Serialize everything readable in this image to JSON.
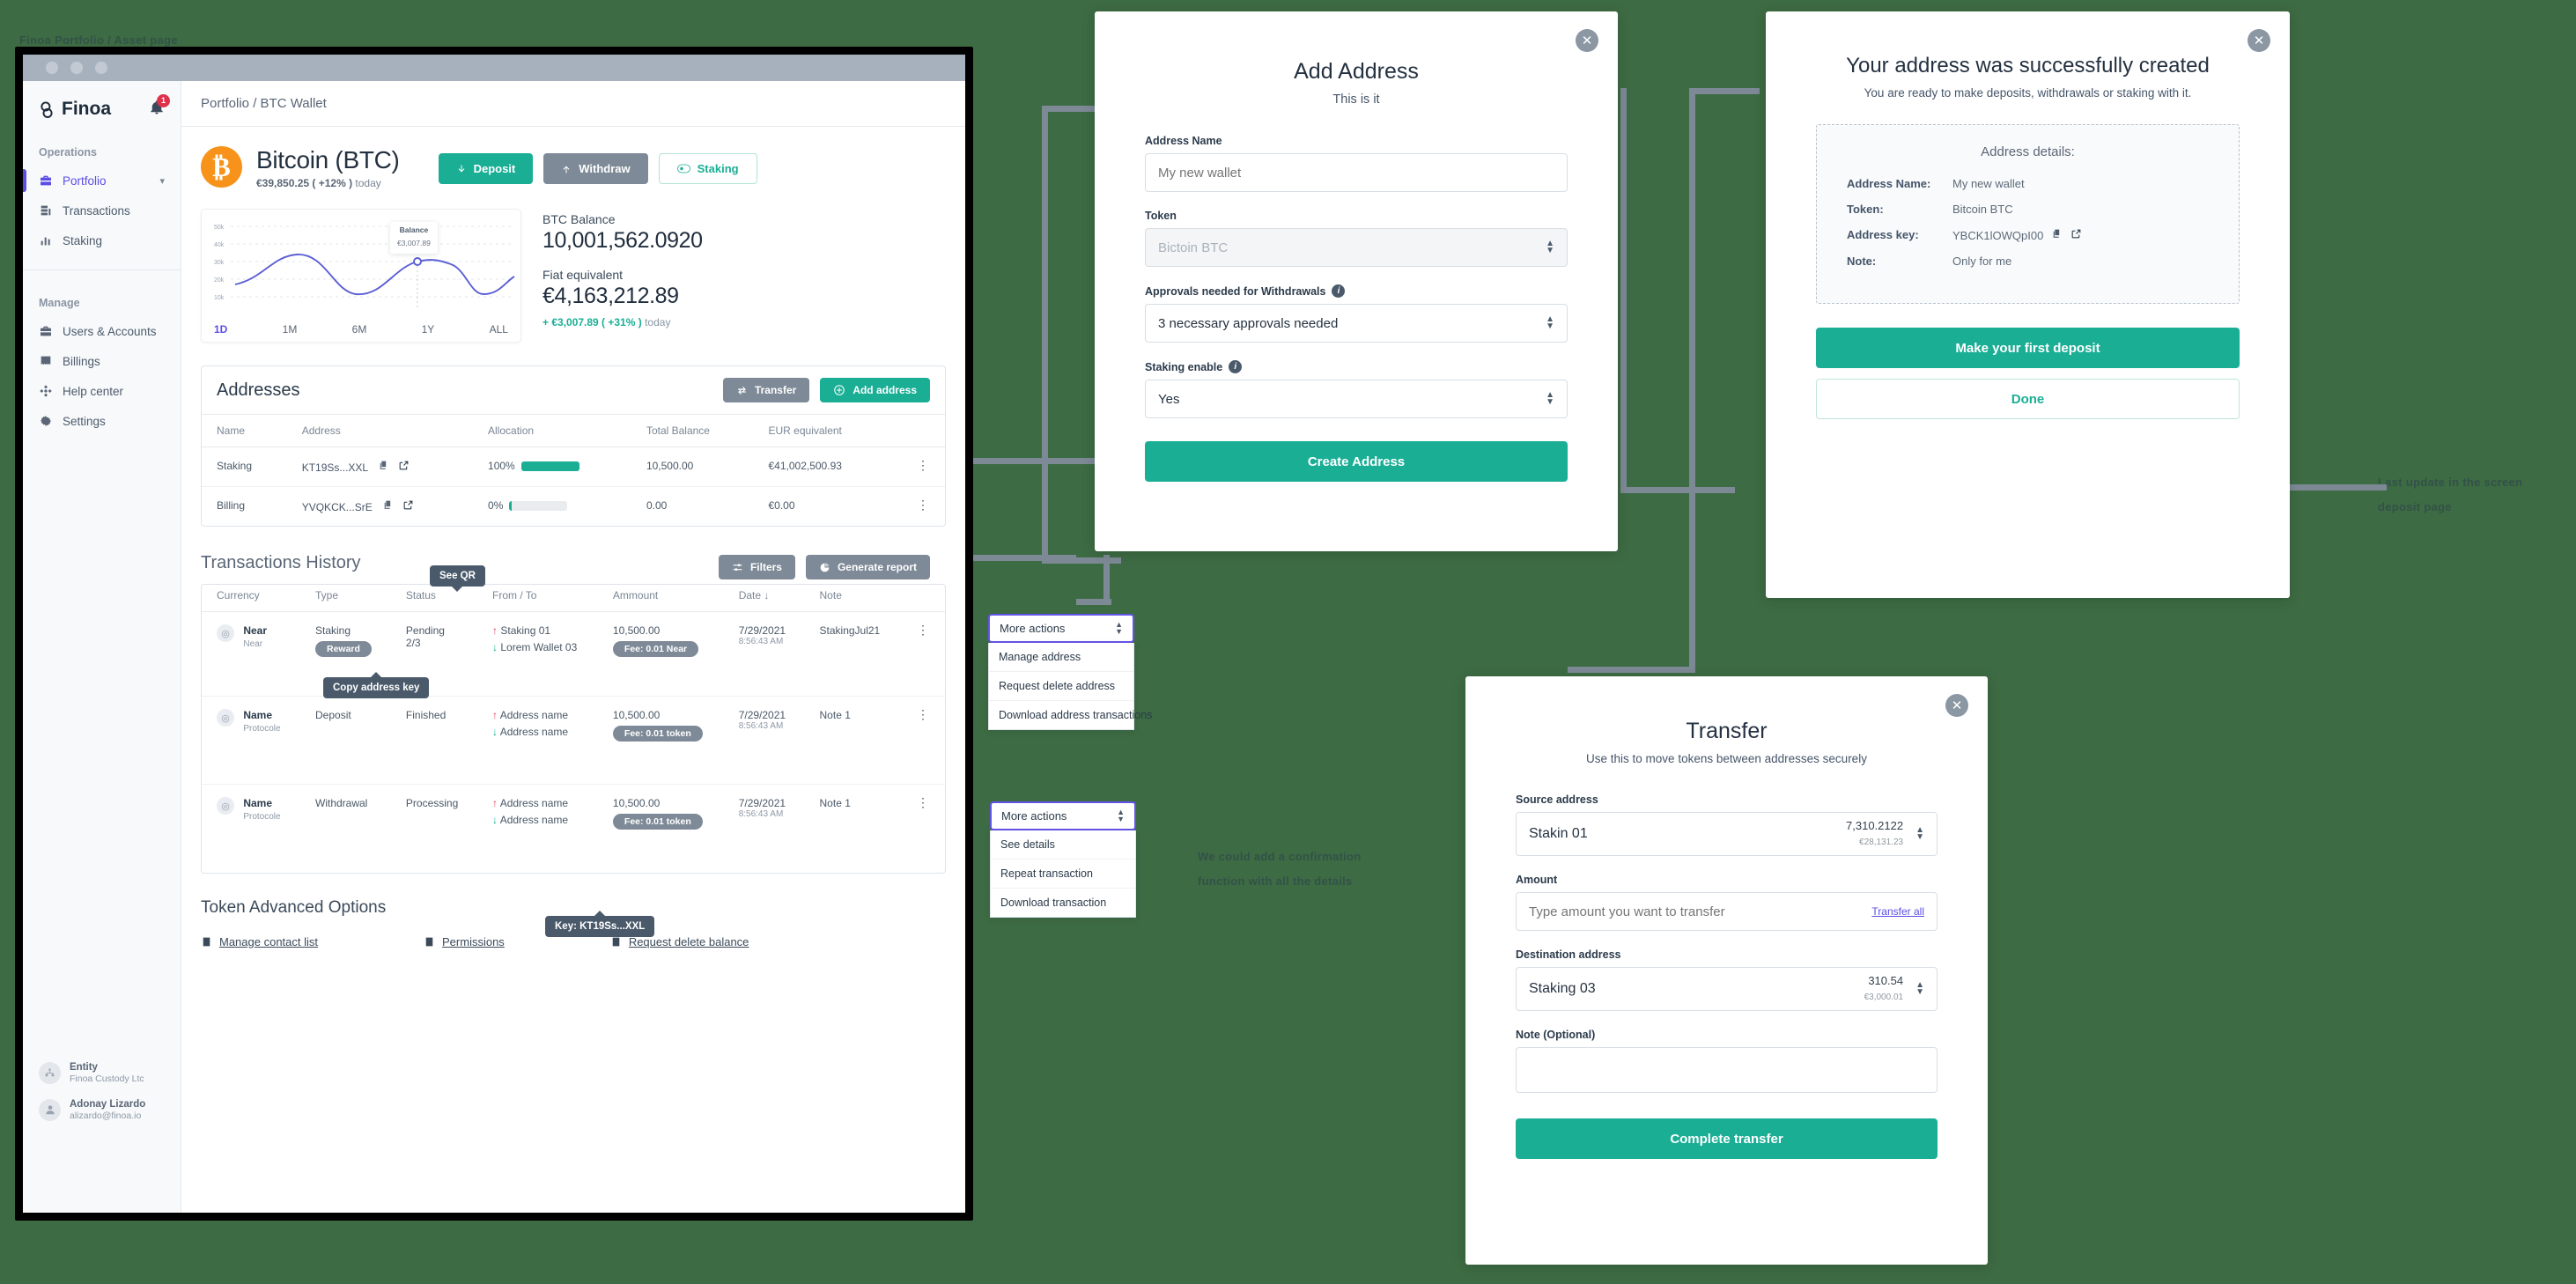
{
  "sketch": {
    "top_label": "Finoa Portfolio / Asset page",
    "right_note_line1": "Last update in the screen",
    "right_note_line2": "deposit page",
    "mid_note_line1": "We could add a confirmation",
    "mid_note_line2": "function with all the details"
  },
  "app": {
    "breadcrumb": "Portfolio / BTC Wallet",
    "brand": "Finoa",
    "notification_count": "1",
    "sidebar": {
      "group_operations": "Operations",
      "group_manage": "Manage",
      "items_operations": [
        {
          "label": "Portfolio",
          "icon": "briefcase-icon",
          "active": true
        },
        {
          "label": "Transactions",
          "icon": "list-icon",
          "active": false
        },
        {
          "label": "Staking",
          "icon": "bars-icon",
          "active": false
        }
      ],
      "items_manage": [
        {
          "label": "Users & Accounts",
          "icon": "briefcase-icon"
        },
        {
          "label": "Billings",
          "icon": "receipt-icon"
        },
        {
          "label": "Help center",
          "icon": "help-icon"
        },
        {
          "label": "Settings",
          "icon": "gear-icon"
        }
      ],
      "entity_label": "Entity",
      "entity_value": "Finoa Custody Ltc",
      "user_name": "Adonay Lizardo",
      "user_email": "alizardo@finoa.io"
    },
    "asset": {
      "name": "Bitcoin (BTC)",
      "price": "€39,850.25 ( +12% )",
      "price_period": "today",
      "symbol": "₿",
      "deposit_label": "Deposit",
      "withdraw_label": "Withdraw",
      "staking_label": "Staking",
      "balance_label": "BTC Balance",
      "balance_value": "10,001,562.0920",
      "fiat_label": "Fiat equivalent",
      "fiat_value": "€4,163,212.89",
      "fiat_change": "+ €3,007.89 ( +31% )",
      "fiat_change_period": "today"
    },
    "chart": {
      "tooltip_label": "Balance",
      "tooltip_value": "€3,007.89",
      "ranges": [
        "1D",
        "1M",
        "6M",
        "1Y",
        "ALL"
      ],
      "active_range": "1D"
    },
    "addresses": {
      "title": "Addresses",
      "transfer_label": "Transfer",
      "add_label": "Add address",
      "columns": [
        "Name",
        "Address",
        "Allocation",
        "Total Balance",
        "EUR equivalent"
      ],
      "rows": [
        {
          "name": "Staking",
          "address": "KT19Ss...XXL",
          "allocation": "100%",
          "alloc_pct": 100,
          "total": "10,500.00",
          "eur": "€41,002,500.93"
        },
        {
          "name": "Billing",
          "address": "YVQKCK...SrE",
          "allocation": "0%",
          "alloc_pct": 3,
          "total": "0.00",
          "eur": "€0.00"
        }
      ],
      "tooltip_qr": "See QR",
      "tooltip_copy": "Copy address key"
    },
    "transactions": {
      "title": "Transactions History",
      "filters_label": "Filters",
      "report_label": "Generate report",
      "columns": [
        "Currency",
        "Type",
        "Status",
        "From / To",
        "Ammount",
        "Date ↓",
        "Note"
      ],
      "tooltip_key": "Key: KT19Ss...XXL",
      "rows": [
        {
          "currency": "Near",
          "currency_sub": "Near",
          "type": "Staking",
          "badge": "Reward",
          "status": "Pending",
          "status_sub": "2/3",
          "from": "Staking 01",
          "to": "Lorem Wallet 03",
          "amount": "10,500.00",
          "fee": "Fee: 0.01 Near",
          "date": "7/29/2021",
          "time": "8:56:43 AM",
          "note": "StakingJul21"
        },
        {
          "currency": "Name",
          "currency_sub": "Protocole",
          "type": "Deposit",
          "badge": "",
          "status": "Finished",
          "status_sub": "",
          "from": "Address name",
          "to": "Address name",
          "amount": "10,500.00",
          "fee": "Fee: 0.01 token",
          "date": "7/29/2021",
          "time": "8:56:43 AM",
          "note": "Note 1"
        },
        {
          "currency": "Name",
          "currency_sub": "Protocole",
          "type": "Withdrawal",
          "badge": "",
          "status": "Processing",
          "status_sub": "",
          "from": "Address name",
          "to": "Address name",
          "amount": "10,500.00",
          "fee": "Fee: 0.01 token",
          "date": "7/29/2021",
          "time": "8:56:43 AM",
          "note": "Note 1"
        }
      ]
    },
    "advanced": {
      "title": "Token Advanced Options",
      "links": [
        "Manage contact list",
        "Permissions",
        "Request delete balance"
      ]
    }
  },
  "dropdown_address": {
    "head": "More actions",
    "items": [
      "Manage address",
      "Request delete address",
      "Download address transactions"
    ]
  },
  "dropdown_transaction": {
    "head": "More actions",
    "items": [
      "See details",
      "Repeat transaction",
      "Download transaction"
    ]
  },
  "add_address_modal": {
    "title": "Add Address",
    "subtitle": "This is it",
    "name_label": "Address Name",
    "name_placeholder": "My new wallet",
    "token_label": "Token",
    "token_value": "Bictoin BTC",
    "approvals_label": "Approvals needed for Withdrawals",
    "approvals_value": "3 necessary approvals needed",
    "staking_label": "Staking enable",
    "staking_value": "Yes",
    "cta": "Create Address"
  },
  "success_modal": {
    "title": "Your address was successfully created",
    "subtitle": "You are ready to make deposits, withdrawals or staking with it.",
    "details_title": "Address details:",
    "rows": [
      {
        "key": "Address Name:",
        "value": "My new wallet",
        "icons": false
      },
      {
        "key": "Token:",
        "value": "Bitcoin BTC",
        "icons": false
      },
      {
        "key": "Address key:",
        "value": "YBCK1lOWQpI00",
        "icons": true
      },
      {
        "key": "Note:",
        "value": "Only for me",
        "icons": false
      }
    ],
    "primary_cta": "Make your first deposit",
    "secondary_cta": "Done"
  },
  "transfer_modal": {
    "title": "Transfer",
    "subtitle": "Use this to move tokens between addresses securely",
    "source_label": "Source address",
    "source_value": "Stakin 01",
    "source_amount": "7,310.2122",
    "source_fiat": "€28,131.23",
    "amount_label": "Amount",
    "amount_placeholder": "Type amount you want to transfer",
    "transfer_all": "Transfer all",
    "dest_label": "Destination address",
    "dest_value": "Staking 03",
    "dest_amount": "310.54",
    "dest_fiat": "€3,000.01",
    "note_label": "Note (Optional)",
    "note_value": "",
    "cta": "Complete transfer"
  }
}
